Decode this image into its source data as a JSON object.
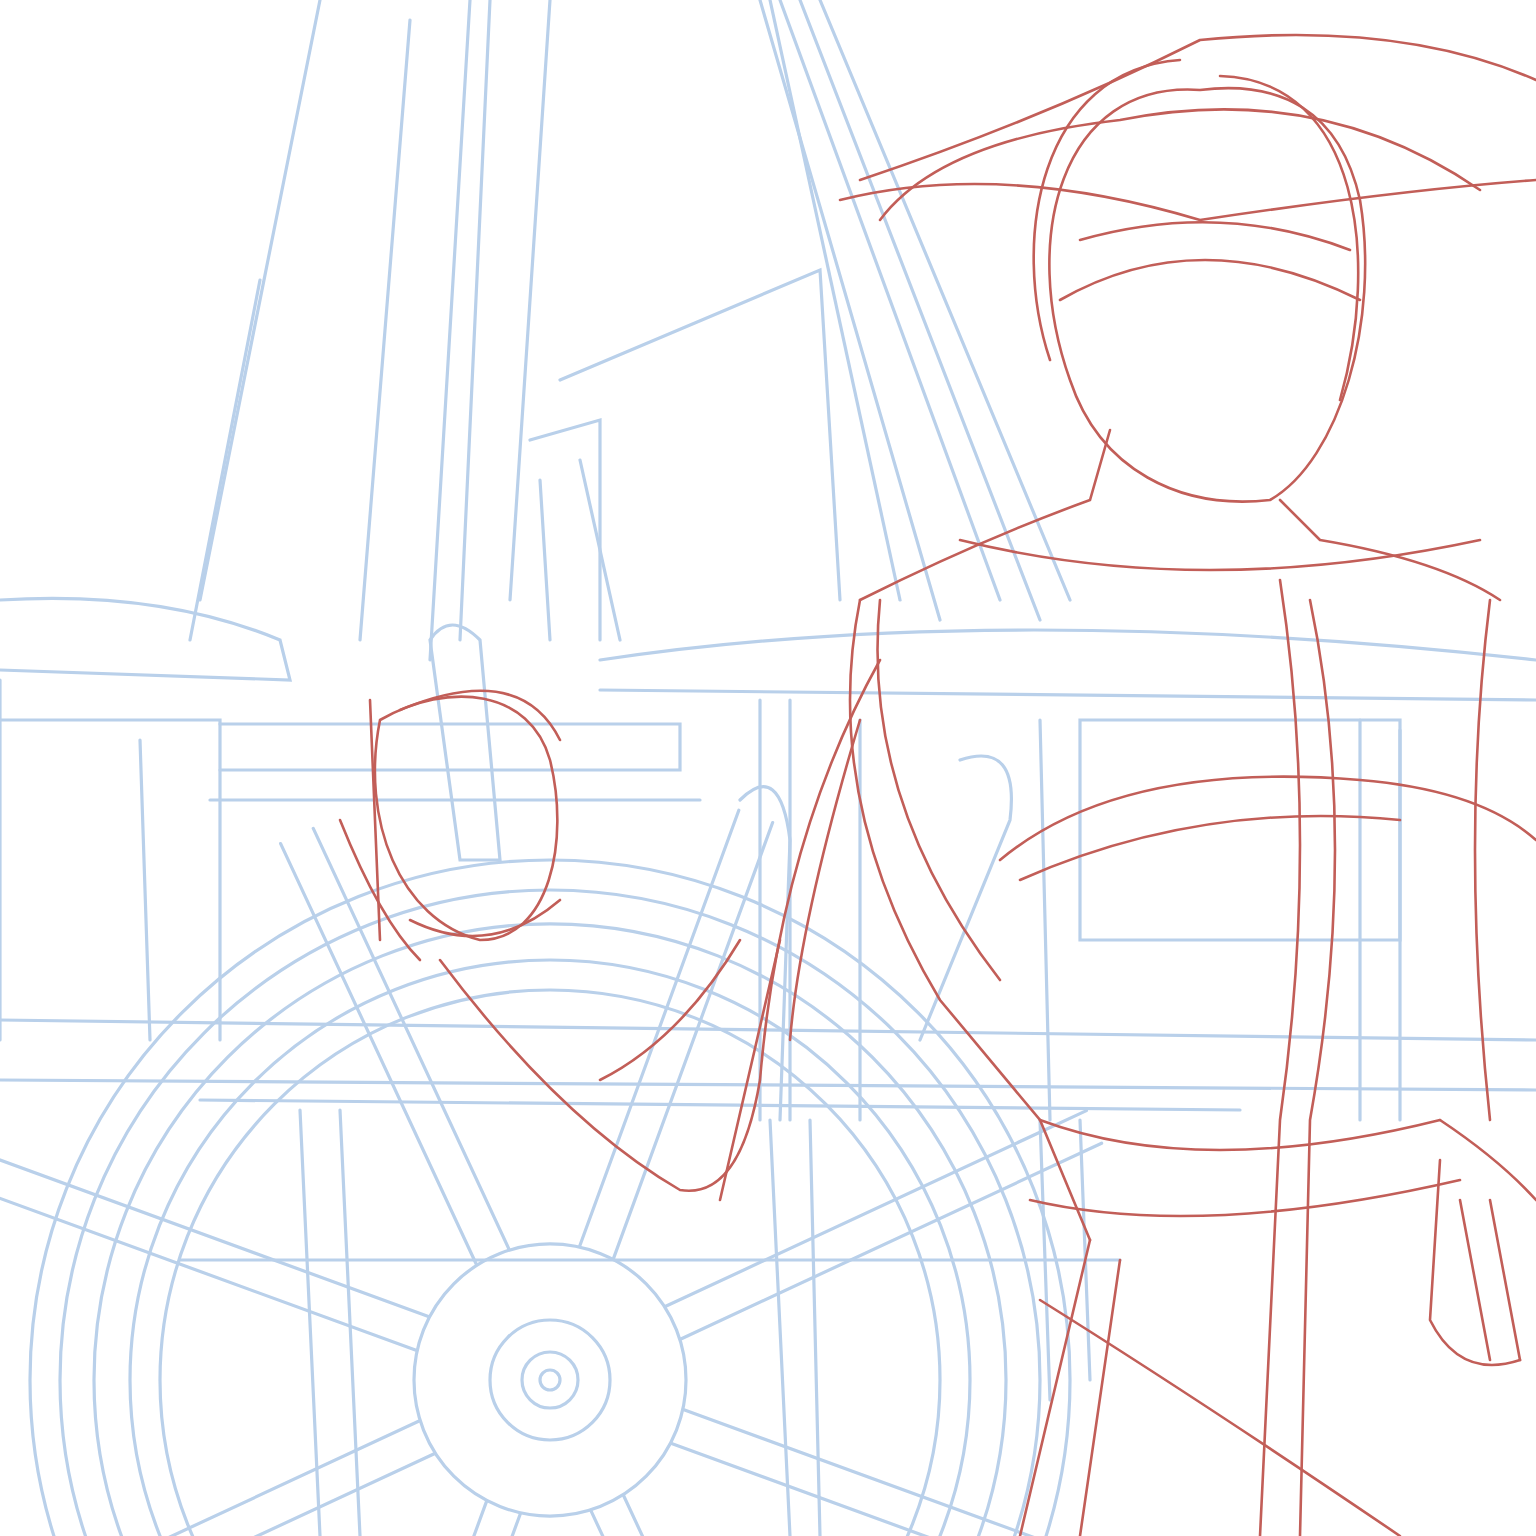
{
  "layers": [
    {
      "kind": "ship",
      "color": "#b9d0ea"
    },
    {
      "kind": "figure",
      "color": "#c25e58"
    }
  ]
}
